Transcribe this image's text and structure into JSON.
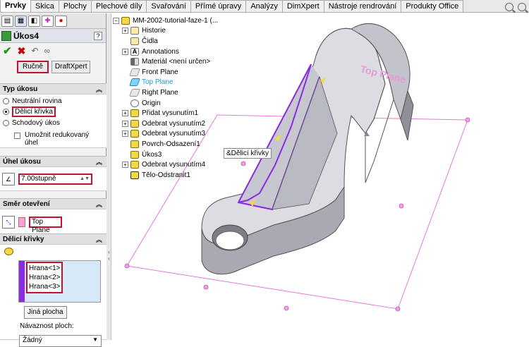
{
  "tabs": [
    "Prvky",
    "Skica",
    "Plochy",
    "Plechové díly",
    "Svařování",
    "Přímé úpravy",
    "Analýzy",
    "DimXpert",
    "Nástroje rendrování",
    "Produkty Office"
  ],
  "active_tab": "Prvky",
  "pm": {
    "title": "Úkos4",
    "help": "?",
    "mode_manual": "Ručně",
    "mode_draftxpert": "DraftXpert",
    "draft_type_header": "Typ úkosu",
    "draft_types": [
      "Neutrální rovina",
      "Dělicí křivka",
      "Schodový úkos"
    ],
    "selected_draft_type": "Dělicí křivka",
    "allow_reduced": "Umožnit redukovaný úhel",
    "angle_header": "Úhel úkosu",
    "angle_value": "7.00stupně",
    "direction_header": "Směr otevření",
    "direction_value": "Top Plane",
    "curves_header": "Dělicí křivky",
    "curves": [
      "Hrana<1>",
      "Hrana<2>",
      "Hrana<3>"
    ],
    "other_face": "Jiná plocha",
    "face_propagation": "Návaznost ploch:",
    "propagation_value": "Žádný"
  },
  "tree": {
    "root": "MM-2002-tutorial-faze-1  (...",
    "items": [
      {
        "label": "Historie",
        "icon": "history-icon",
        "exp": "+"
      },
      {
        "label": "Čidla",
        "icon": "sensor-icon",
        "exp": ""
      },
      {
        "label": "Annotations",
        "icon": "annotation-icon",
        "exp": "+"
      },
      {
        "label": "Materiál <není určen>",
        "icon": "material-icon",
        "exp": ""
      },
      {
        "label": "Front Plane",
        "icon": "plane-icon",
        "exp": ""
      },
      {
        "label": "Top Plane",
        "icon": "plane-icon",
        "exp": "",
        "selected": true
      },
      {
        "label": "Right Plane",
        "icon": "plane-icon",
        "exp": ""
      },
      {
        "label": "Origin",
        "icon": "origin-icon",
        "exp": ""
      },
      {
        "label": "Přidat vysunutím1",
        "icon": "extrude-icon",
        "exp": "+"
      },
      {
        "label": "Odebrat vysunutím2",
        "icon": "cut-extrude-icon",
        "exp": "+"
      },
      {
        "label": "Odebrat vysunutím3",
        "icon": "cut-extrude-icon",
        "exp": "+"
      },
      {
        "label": "Povrch-Odsazení1",
        "icon": "offset-surface-icon",
        "exp": ""
      },
      {
        "label": "Úkos3",
        "icon": "draft-icon",
        "exp": ""
      },
      {
        "label": "Odebrat vysunutím4",
        "icon": "cut-extrude-icon",
        "exp": "+"
      },
      {
        "label": "Tělo-Odstranit1",
        "icon": "delete-body-icon",
        "exp": ""
      }
    ]
  },
  "viewport": {
    "plane_label": "Top Plane",
    "tooltip": "&Dělicí křivky"
  },
  "colors": {
    "highlight": "#c8102e",
    "selection": "#8a2be2",
    "plane": "#e678d8"
  }
}
